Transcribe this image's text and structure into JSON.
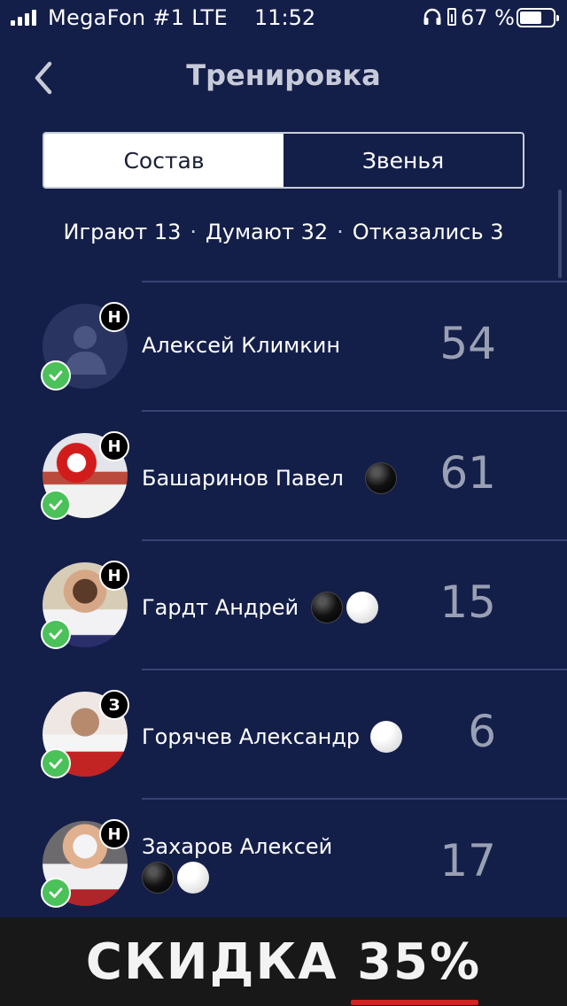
{
  "status_bar": {
    "carrier": "MegaFon #1 LTE",
    "time": "11:52",
    "battery_pct": "67 %"
  },
  "nav": {
    "title": "Тренировка"
  },
  "tabs": [
    {
      "label": "Состав",
      "active": true
    },
    {
      "label": "Звенья",
      "active": false
    }
  ],
  "stats": {
    "playing": "Играют 13",
    "thinking": "Думают 32",
    "declined": "Отказались 3",
    "separator": "·"
  },
  "players": [
    {
      "name": "Алексей Климкин",
      "number": "54",
      "badge": "Н",
      "confirmed": true,
      "pucks": []
    },
    {
      "name": "Башаринов Павел",
      "number": "61",
      "badge": "Н",
      "confirmed": true,
      "pucks": [
        "black"
      ]
    },
    {
      "name": "Гардт Андрей",
      "number": "15",
      "badge": "Н",
      "confirmed": true,
      "pucks": [
        "black",
        "white"
      ]
    },
    {
      "name": "Горячев Александр",
      "number": "6",
      "badge": "З",
      "confirmed": true,
      "pucks": [
        "white"
      ]
    },
    {
      "name": "Захаров Алексей",
      "number": "17",
      "badge": "Н",
      "confirmed": true,
      "pucks": [
        "black",
        "white"
      ]
    }
  ],
  "banner": {
    "text": "СКИДКА 35%"
  },
  "colors": {
    "background": "#141f49",
    "confirmed_badge": "#4bc159",
    "number": "#9aa0b4",
    "banner_accent": "#d22222"
  }
}
